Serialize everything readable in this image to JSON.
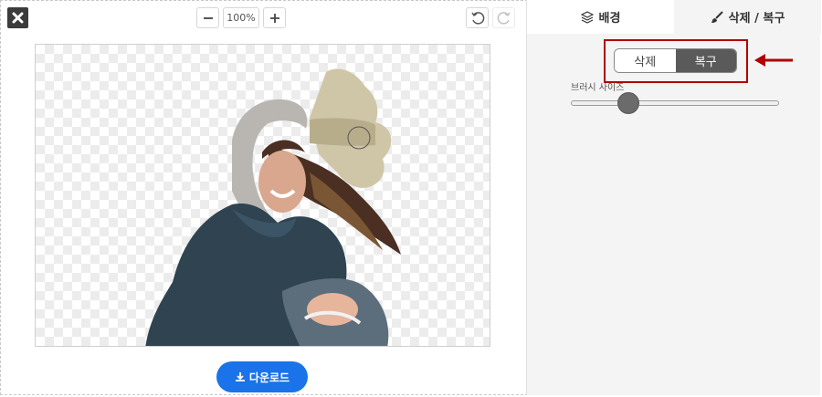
{
  "toolbar": {
    "close_icon": "close-icon",
    "zoom_out_icon": "minus-icon",
    "zoom_in_icon": "plus-icon",
    "zoom_level": "100%",
    "undo_icon": "undo-icon",
    "redo_icon": "redo-icon"
  },
  "canvas": {
    "background": "transparent-checkerboard",
    "subject": "woman in hoodie and denim jacket"
  },
  "download": {
    "label": "다운로드",
    "icon": "download-icon",
    "color": "#1a73e8"
  },
  "panel": {
    "tabs": [
      {
        "label": "배경",
        "icon": "layers-icon"
      },
      {
        "label": "삭제 / 복구",
        "icon": "brush-icon"
      }
    ],
    "mode_toggle": {
      "options": [
        "삭제",
        "복구"
      ],
      "selected": "복구"
    },
    "brush_size": {
      "label": "브러시 사이즈",
      "value_fraction": 0.27
    },
    "annotation_color": "#b00000"
  }
}
